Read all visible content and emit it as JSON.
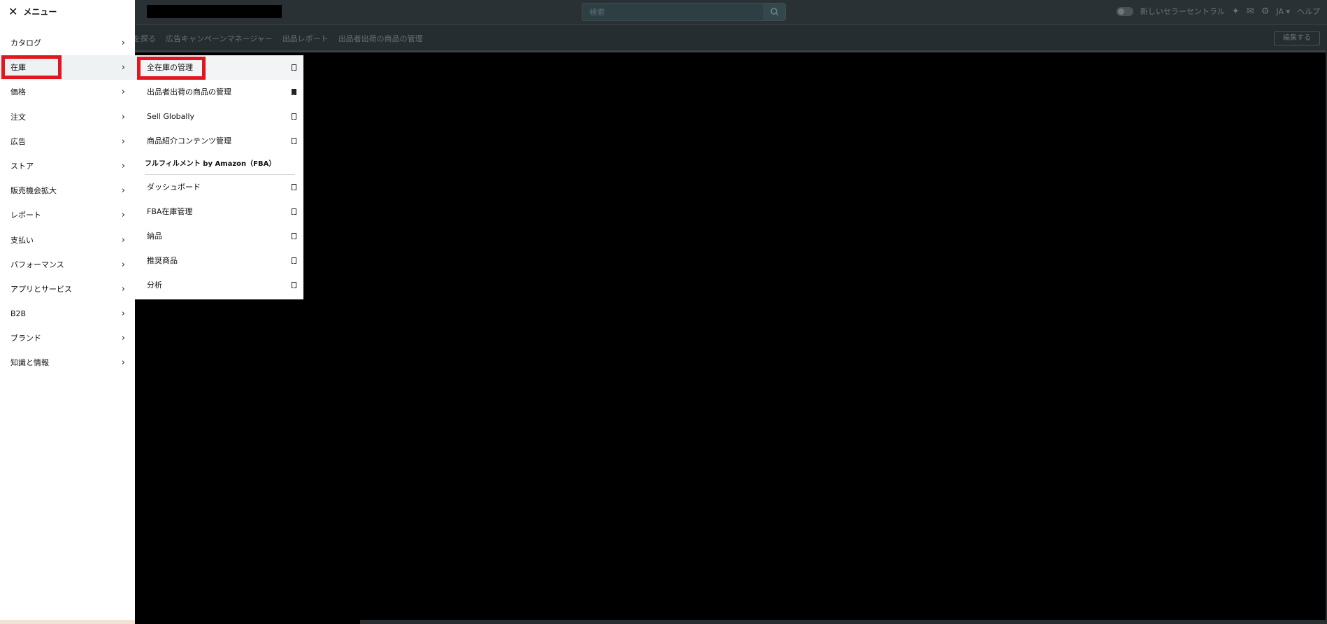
{
  "topbar": {
    "search_placeholder": "検索",
    "new_seller_central_label": "新しいセラーセントラル",
    "language": "JA",
    "help": "ヘルプ"
  },
  "subnav": {
    "links": [
      "を探る",
      "広告キャンペーンマネージャー",
      "出品レポート",
      "出品者出荷の商品の管理"
    ],
    "edit_label": "編集する"
  },
  "menu": {
    "title": "メニュー",
    "items": [
      {
        "label": "カタログ"
      },
      {
        "label": "在庫"
      },
      {
        "label": "価格"
      },
      {
        "label": "注文"
      },
      {
        "label": "広告"
      },
      {
        "label": "ストア"
      },
      {
        "label": "販売機会拡大"
      },
      {
        "label": "レポート"
      },
      {
        "label": "支払い"
      },
      {
        "label": "パフォーマンス"
      },
      {
        "label": "アプリとサービス"
      },
      {
        "label": "B2B"
      },
      {
        "label": "ブランド"
      },
      {
        "label": "知識と情報"
      }
    ],
    "active_index": 1
  },
  "submenu": {
    "items": [
      {
        "label": "全在庫の管理",
        "bookmarked": false
      },
      {
        "label": "出品者出荷の商品の管理",
        "bookmarked": true
      },
      {
        "label": "Sell Globally",
        "bookmarked": false
      },
      {
        "label": "商品紹介コンテンツ管理",
        "bookmarked": false
      }
    ],
    "section_title": "フルフィルメント by Amazon（FBA）",
    "fba_items": [
      {
        "label": "ダッシュボード",
        "bookmarked": false
      },
      {
        "label": "FBA在庫管理",
        "bookmarked": false
      },
      {
        "label": "納品",
        "bookmarked": false
      },
      {
        "label": "推奨商品",
        "bookmarked": false
      },
      {
        "label": "分析",
        "bookmarked": false
      }
    ]
  },
  "colors": {
    "highlight": "#e3151f",
    "topbar": "#2a3134"
  }
}
